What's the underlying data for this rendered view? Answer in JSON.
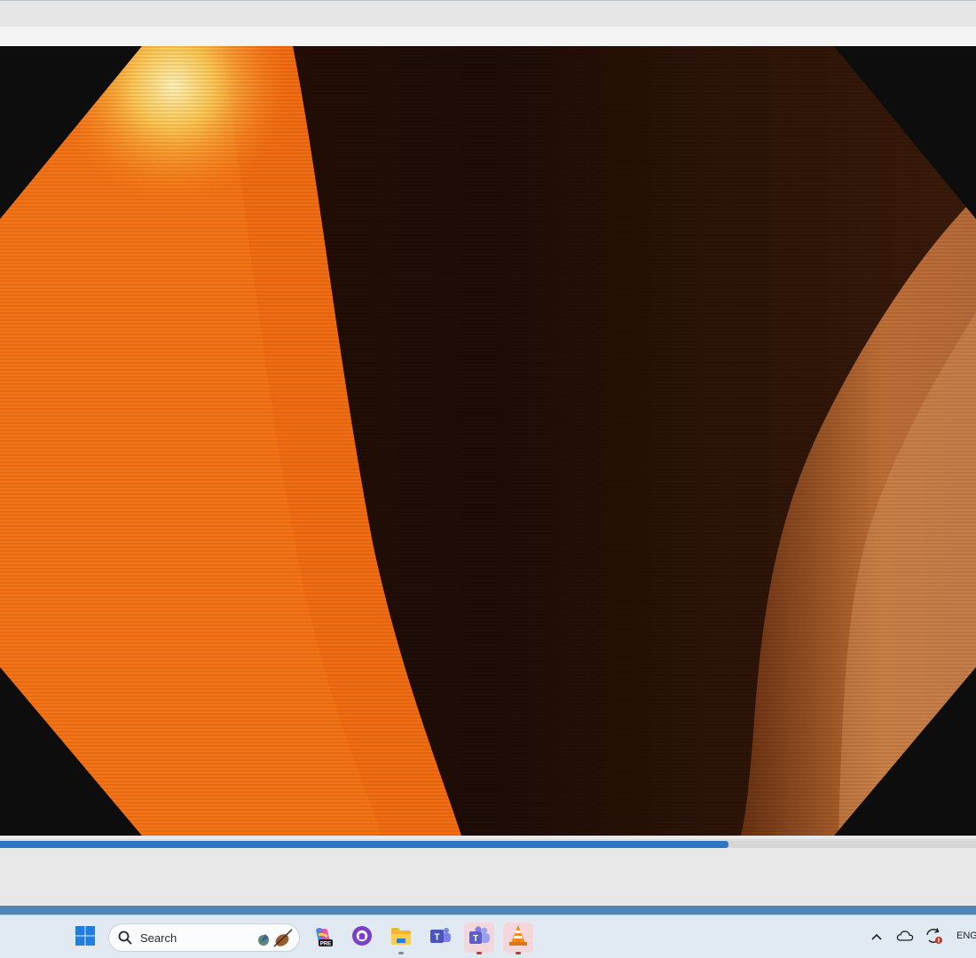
{
  "player": {
    "progress_fraction": 0.746
  },
  "taskbar": {
    "search_placeholder": "Search",
    "apps": [
      {
        "name": "Copilot",
        "badge": "PRE"
      },
      {
        "name": "GitHub"
      },
      {
        "name": "File Explorer"
      },
      {
        "name": "Microsoft Teams (classic)"
      },
      {
        "name": "Microsoft Teams"
      },
      {
        "name": "VLC media player"
      }
    ],
    "tray": {
      "language": "ENG"
    }
  },
  "colors": {
    "accent": "#2f73c4",
    "taskbar_bg": "#e1e9f2",
    "teams": "#5b5fc7",
    "vlc": "#f08a1c"
  }
}
